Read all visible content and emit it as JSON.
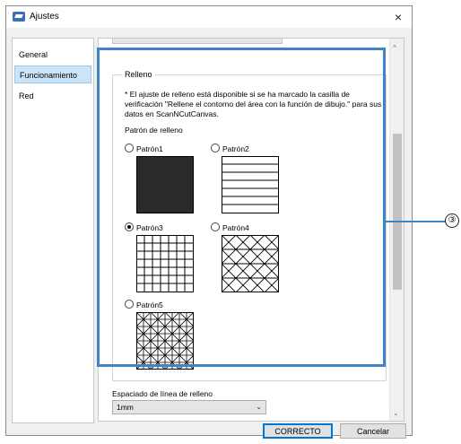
{
  "window": {
    "title": "Ajustes",
    "close_glyph": "×",
    "app_icon": "scanncut-app-icon"
  },
  "sidebar": {
    "items": [
      {
        "label": "General"
      },
      {
        "label": "Funcionamiento",
        "selected": true
      },
      {
        "label": "Red"
      }
    ]
  },
  "fill": {
    "group_title": "Relleno",
    "note": "* El ajuste de relleno está disponible si se ha marcado la casilla de verificación \"Rellene el contorno del área con la función de dibujo.\" para sus datos en ScanNCutCanvas.",
    "pattern_heading": "Patrón de relleno",
    "patterns": [
      {
        "label": "Patrón1",
        "selected": false,
        "style": "solid"
      },
      {
        "label": "Patrón2",
        "selected": false,
        "style": "horizontal-lines"
      },
      {
        "label": "Patrón3",
        "selected": true,
        "style": "grid"
      },
      {
        "label": "Patrón4",
        "selected": false,
        "style": "triangle-lattice"
      },
      {
        "label": "Patrón5",
        "selected": false,
        "style": "grid-with-diagonals"
      }
    ]
  },
  "line_spacing": {
    "label": "Espaciado de línea de relleno",
    "value": "1mm",
    "chevron": "⌄"
  },
  "scrollbar": {
    "up": "^",
    "down": "⌄"
  },
  "buttons": {
    "ok": "CORRECTO",
    "cancel": "Cancelar"
  },
  "callout": {
    "number": "③",
    "color": "#3d84c6"
  }
}
